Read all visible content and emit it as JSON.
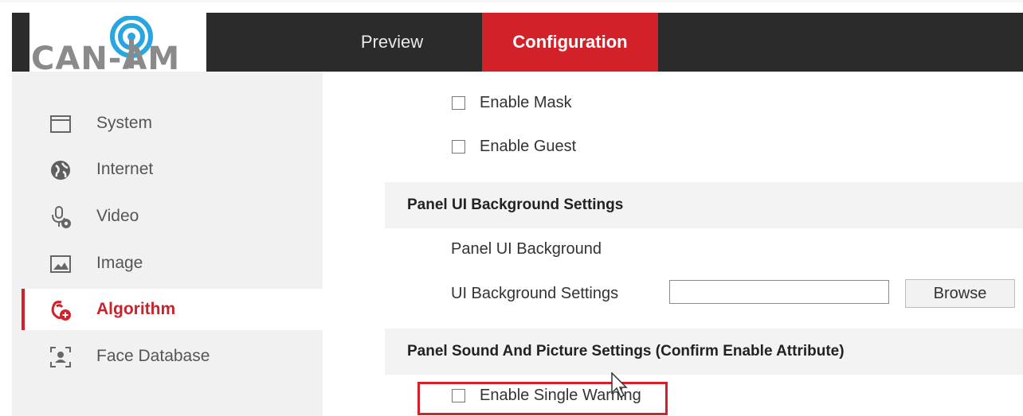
{
  "header": {
    "logo_text": "CAN-AM",
    "tabs": [
      {
        "label": "Preview",
        "active": false
      },
      {
        "label": "Configuration",
        "active": true
      }
    ]
  },
  "sidebar": {
    "items": [
      {
        "label": "System",
        "icon": "window-icon"
      },
      {
        "label": "Internet",
        "icon": "globe-icon"
      },
      {
        "label": "Video",
        "icon": "microphone-icon"
      },
      {
        "label": "Image",
        "icon": "image-icon"
      },
      {
        "label": "Algorithm",
        "icon": "algorithm-icon",
        "active": true
      },
      {
        "label": "Face Database",
        "icon": "face-scan-icon"
      }
    ]
  },
  "content": {
    "enable_mask": "Enable Mask",
    "enable_guest": "Enable Guest",
    "panel_ui_section": "Panel UI Background Settings",
    "panel_ui_background": "Panel UI Background",
    "ui_background_settings": "UI Background Settings",
    "ui_background_value": "",
    "browse_label": "Browse",
    "sound_section": "Panel Sound And Picture Settings (Confirm Enable Attribute)",
    "enable_single_warning": "Enable Single Warning"
  },
  "colors": {
    "accent": "#d3212a",
    "topbar": "#2b2b2b",
    "sidebar_bg": "#f1f1f1"
  }
}
